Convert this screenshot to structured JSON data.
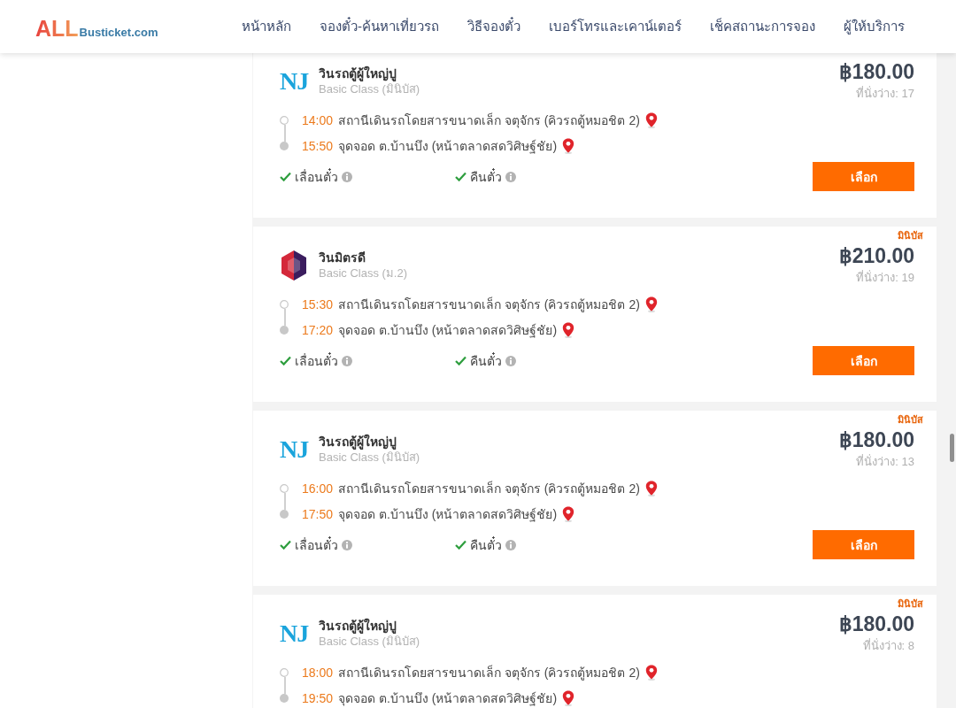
{
  "header": {
    "logo": {
      "brand": "ALL",
      "domain": "Busticket.com"
    },
    "nav": [
      "หน้าหลัก",
      "จองตั๋ว-ค้นหาเที่ยวรถ",
      "วิธีจองตั๋ว",
      "เบอร์โทรและเคาน์เตอร์",
      "เช็คสถานะการจอง",
      "ผู้ให้บริการ"
    ]
  },
  "trips": [
    {
      "logo": {
        "kind": "lettermark",
        "text": "NJ"
      },
      "operator": "วินรถตู้ผู้ใหญ่ปู",
      "bus_class": "Basic Class (มินิบัส)",
      "price": "฿180.00",
      "seats": "ที่นั่งว่าง: 17",
      "stops": [
        {
          "kind": "departure",
          "time": "14:00",
          "place": "สถานีเดินรถโดยสารขนาดเล็ก จตุจักร (คิวรถตู้หมอชิต 2)"
        },
        {
          "kind": "arrival",
          "time": "15:50",
          "place": "จุดจอด ต.บ้านบึง (หน้าตลาดสดวิศิษฐ์ชัย)"
        }
      ],
      "features": [
        {
          "label": "เลื่อนตั๋ว",
          "available": true
        },
        {
          "label": "คืนตั๋ว",
          "available": true
        }
      ],
      "button": "เลือก"
    },
    {
      "tag": "มินิบัส",
      "logo": {
        "kind": "emblem"
      },
      "operator": "วินมิตรดี",
      "bus_class": "Basic Class (ม.2)",
      "price": "฿210.00",
      "seats": "ที่นั่งว่าง: 19",
      "stops": [
        {
          "kind": "departure",
          "time": "15:30",
          "place": "สถานีเดินรถโดยสารขนาดเล็ก จตุจักร (คิวรถตู้หมอชิต 2)"
        },
        {
          "kind": "arrival",
          "time": "17:20",
          "place": "จุดจอด ต.บ้านบึง (หน้าตลาดสดวิศิษฐ์ชัย)"
        }
      ],
      "features": [
        {
          "label": "เลื่อนตั๋ว",
          "available": true
        },
        {
          "label": "คืนตั๋ว",
          "available": true
        }
      ],
      "button": "เลือก"
    },
    {
      "tag": "มินิบัส",
      "logo": {
        "kind": "lettermark",
        "text": "NJ"
      },
      "operator": "วินรถตู้ผู้ใหญ่ปู",
      "bus_class": "Basic Class (มินิบัส)",
      "price": "฿180.00",
      "seats": "ที่นั่งว่าง: 13",
      "stops": [
        {
          "kind": "departure",
          "time": "16:00",
          "place": "สถานีเดินรถโดยสารขนาดเล็ก จตุจักร (คิวรถตู้หมอชิต 2)"
        },
        {
          "kind": "arrival",
          "time": "17:50",
          "place": "จุดจอด ต.บ้านบึง (หน้าตลาดสดวิศิษฐ์ชัย)"
        }
      ],
      "features": [
        {
          "label": "เลื่อนตั๋ว",
          "available": true
        },
        {
          "label": "คืนตั๋ว",
          "available": true
        }
      ],
      "button": "เลือก"
    },
    {
      "tag": "มินิบัส",
      "logo": {
        "kind": "lettermark",
        "text": "NJ"
      },
      "operator": "วินรถตู้ผู้ใหญ่ปู",
      "bus_class": "Basic Class (มินิบัส)",
      "price": "฿180.00",
      "seats": "ที่นั่งว่าง: 8",
      "stops": [
        {
          "kind": "departure",
          "time": "18:00",
          "place": "สถานีเดินรถโดยสารขนาดเล็ก จตุจักร (คิวรถตู้หมอชิต 2)"
        },
        {
          "kind": "arrival",
          "time": "19:50",
          "place": "จุดจอด ต.บ้านบึง (หน้าตลาดสดวิศิษฐ์ชัย)"
        }
      ]
    }
  ]
}
